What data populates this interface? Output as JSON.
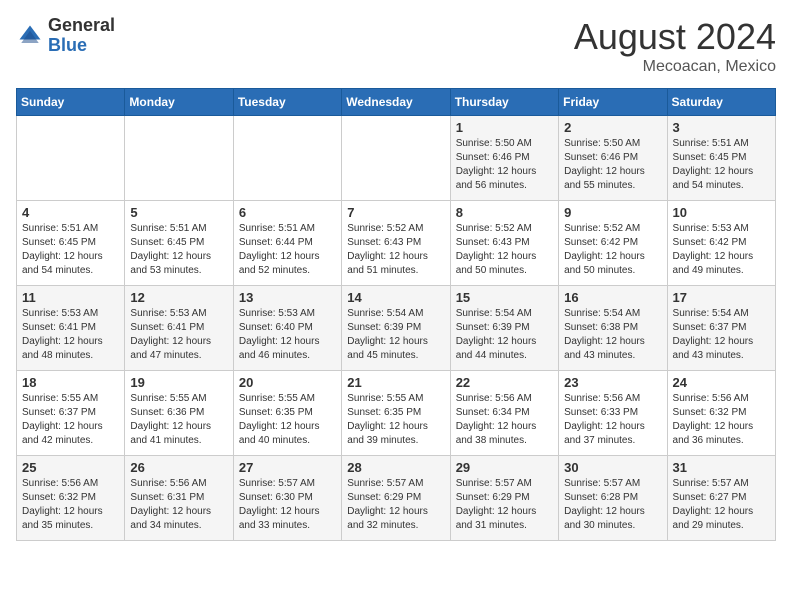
{
  "header": {
    "logo_general": "General",
    "logo_blue": "Blue",
    "month_year": "August 2024",
    "location": "Mecoacan, Mexico"
  },
  "weekdays": [
    "Sunday",
    "Monday",
    "Tuesday",
    "Wednesday",
    "Thursday",
    "Friday",
    "Saturday"
  ],
  "weeks": [
    [
      {
        "day": "",
        "info": ""
      },
      {
        "day": "",
        "info": ""
      },
      {
        "day": "",
        "info": ""
      },
      {
        "day": "",
        "info": ""
      },
      {
        "day": "1",
        "info": "Sunrise: 5:50 AM\nSunset: 6:46 PM\nDaylight: 12 hours\nand 56 minutes."
      },
      {
        "day": "2",
        "info": "Sunrise: 5:50 AM\nSunset: 6:46 PM\nDaylight: 12 hours\nand 55 minutes."
      },
      {
        "day": "3",
        "info": "Sunrise: 5:51 AM\nSunset: 6:45 PM\nDaylight: 12 hours\nand 54 minutes."
      }
    ],
    [
      {
        "day": "4",
        "info": "Sunrise: 5:51 AM\nSunset: 6:45 PM\nDaylight: 12 hours\nand 54 minutes."
      },
      {
        "day": "5",
        "info": "Sunrise: 5:51 AM\nSunset: 6:45 PM\nDaylight: 12 hours\nand 53 minutes."
      },
      {
        "day": "6",
        "info": "Sunrise: 5:51 AM\nSunset: 6:44 PM\nDaylight: 12 hours\nand 52 minutes."
      },
      {
        "day": "7",
        "info": "Sunrise: 5:52 AM\nSunset: 6:43 PM\nDaylight: 12 hours\nand 51 minutes."
      },
      {
        "day": "8",
        "info": "Sunrise: 5:52 AM\nSunset: 6:43 PM\nDaylight: 12 hours\nand 50 minutes."
      },
      {
        "day": "9",
        "info": "Sunrise: 5:52 AM\nSunset: 6:42 PM\nDaylight: 12 hours\nand 50 minutes."
      },
      {
        "day": "10",
        "info": "Sunrise: 5:53 AM\nSunset: 6:42 PM\nDaylight: 12 hours\nand 49 minutes."
      }
    ],
    [
      {
        "day": "11",
        "info": "Sunrise: 5:53 AM\nSunset: 6:41 PM\nDaylight: 12 hours\nand 48 minutes."
      },
      {
        "day": "12",
        "info": "Sunrise: 5:53 AM\nSunset: 6:41 PM\nDaylight: 12 hours\nand 47 minutes."
      },
      {
        "day": "13",
        "info": "Sunrise: 5:53 AM\nSunset: 6:40 PM\nDaylight: 12 hours\nand 46 minutes."
      },
      {
        "day": "14",
        "info": "Sunrise: 5:54 AM\nSunset: 6:39 PM\nDaylight: 12 hours\nand 45 minutes."
      },
      {
        "day": "15",
        "info": "Sunrise: 5:54 AM\nSunset: 6:39 PM\nDaylight: 12 hours\nand 44 minutes."
      },
      {
        "day": "16",
        "info": "Sunrise: 5:54 AM\nSunset: 6:38 PM\nDaylight: 12 hours\nand 43 minutes."
      },
      {
        "day": "17",
        "info": "Sunrise: 5:54 AM\nSunset: 6:37 PM\nDaylight: 12 hours\nand 43 minutes."
      }
    ],
    [
      {
        "day": "18",
        "info": "Sunrise: 5:55 AM\nSunset: 6:37 PM\nDaylight: 12 hours\nand 42 minutes."
      },
      {
        "day": "19",
        "info": "Sunrise: 5:55 AM\nSunset: 6:36 PM\nDaylight: 12 hours\nand 41 minutes."
      },
      {
        "day": "20",
        "info": "Sunrise: 5:55 AM\nSunset: 6:35 PM\nDaylight: 12 hours\nand 40 minutes."
      },
      {
        "day": "21",
        "info": "Sunrise: 5:55 AM\nSunset: 6:35 PM\nDaylight: 12 hours\nand 39 minutes."
      },
      {
        "day": "22",
        "info": "Sunrise: 5:56 AM\nSunset: 6:34 PM\nDaylight: 12 hours\nand 38 minutes."
      },
      {
        "day": "23",
        "info": "Sunrise: 5:56 AM\nSunset: 6:33 PM\nDaylight: 12 hours\nand 37 minutes."
      },
      {
        "day": "24",
        "info": "Sunrise: 5:56 AM\nSunset: 6:32 PM\nDaylight: 12 hours\nand 36 minutes."
      }
    ],
    [
      {
        "day": "25",
        "info": "Sunrise: 5:56 AM\nSunset: 6:32 PM\nDaylight: 12 hours\nand 35 minutes."
      },
      {
        "day": "26",
        "info": "Sunrise: 5:56 AM\nSunset: 6:31 PM\nDaylight: 12 hours\nand 34 minutes."
      },
      {
        "day": "27",
        "info": "Sunrise: 5:57 AM\nSunset: 6:30 PM\nDaylight: 12 hours\nand 33 minutes."
      },
      {
        "day": "28",
        "info": "Sunrise: 5:57 AM\nSunset: 6:29 PM\nDaylight: 12 hours\nand 32 minutes."
      },
      {
        "day": "29",
        "info": "Sunrise: 5:57 AM\nSunset: 6:29 PM\nDaylight: 12 hours\nand 31 minutes."
      },
      {
        "day": "30",
        "info": "Sunrise: 5:57 AM\nSunset: 6:28 PM\nDaylight: 12 hours\nand 30 minutes."
      },
      {
        "day": "31",
        "info": "Sunrise: 5:57 AM\nSunset: 6:27 PM\nDaylight: 12 hours\nand 29 minutes."
      }
    ]
  ]
}
